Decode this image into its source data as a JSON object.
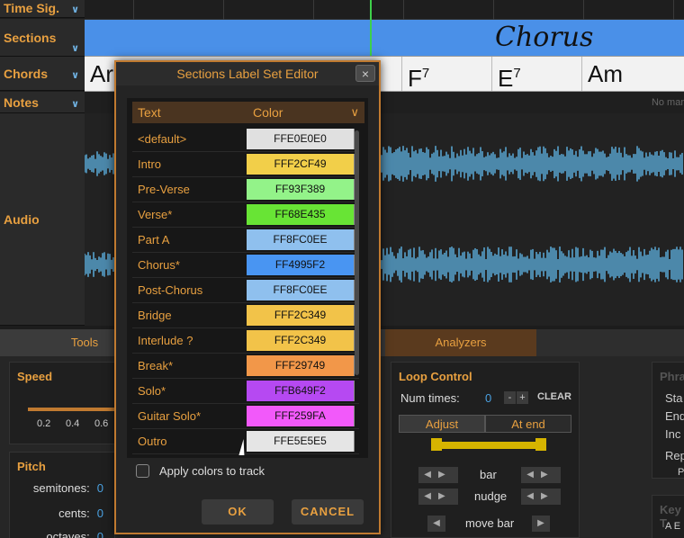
{
  "tracks": {
    "time_sig": "Time Sig.",
    "sections": "Sections",
    "chords": "Chords",
    "notes": "Notes",
    "audio": "Audio"
  },
  "timeline": {
    "section_label": "Chorus",
    "chords": [
      {
        "root": "Ar",
        "sup": ""
      },
      {
        "root": "F",
        "sup": "7"
      },
      {
        "root": "E",
        "sup": "7"
      },
      {
        "root": "Am",
        "sup": ""
      }
    ],
    "no_marker": "No mar",
    "waveform_color": "#5aaad8",
    "playhead_color": "#3ed04a"
  },
  "tabs": {
    "tools": "Tools",
    "analyzers": "Analyzers"
  },
  "speed": {
    "title": "Speed",
    "ticks": [
      "0.2",
      "0.4",
      "0.6"
    ]
  },
  "pitch": {
    "title": "Pitch",
    "rows": [
      {
        "label": "semitones:",
        "value": "0"
      },
      {
        "label": "cents:",
        "value": "0"
      },
      {
        "label": "octaves:",
        "value": "0"
      }
    ]
  },
  "loop": {
    "title": "Loop Control",
    "num_times_label": "Num times:",
    "num_times_value": "0",
    "minus": "-",
    "plus": "+",
    "clear": "CLEAR",
    "adjust": "Adjust",
    "at_end": "At end",
    "bar": "bar",
    "nudge": "nudge",
    "move_bar": "move bar"
  },
  "phrase": {
    "title": "Phra",
    "rows": [
      "Sta",
      "End",
      "Inc",
      "Rep",
      "P"
    ]
  },
  "key": {
    "title": "Key T",
    "value": "A E"
  },
  "dialog": {
    "title": "Sections Label Set Editor",
    "close": "×",
    "header_text": "Text",
    "header_color": "Color",
    "rows": [
      {
        "label": "<default>",
        "code": "FFE0E0E0",
        "color": "#e0e0e0"
      },
      {
        "label": "Intro",
        "code": "FFF2CF49",
        "color": "#f2cf49"
      },
      {
        "label": "Pre-Verse",
        "code": "FF93F389",
        "color": "#93f389"
      },
      {
        "label": "Verse*",
        "code": "FF68E435",
        "color": "#68e435"
      },
      {
        "label": "Part A",
        "code": "FF8FC0EE",
        "color": "#8fc0ee"
      },
      {
        "label": "Chorus*",
        "code": "FF4995F2",
        "color": "#4995f2"
      },
      {
        "label": "Post-Chorus",
        "code": "FF8FC0EE",
        "color": "#8fc0ee"
      },
      {
        "label": "Bridge",
        "code": "FFF2C349",
        "color": "#f2c349"
      },
      {
        "label": "Interlude ?",
        "code": "FFF2C349",
        "color": "#f2c349"
      },
      {
        "label": "Break*",
        "code": "FFF29749",
        "color": "#f29749"
      },
      {
        "label": "Solo*",
        "code": "FFB649F2",
        "color": "#b649f2"
      },
      {
        "label": "Guitar Solo*",
        "code": "FFF259FA",
        "color": "#f259fa"
      },
      {
        "label": "Outro",
        "code": "FFE5E5E5",
        "color": "#e5e5e5"
      }
    ],
    "apply_label": "Apply colors to track",
    "ok": "OK",
    "cancel": "CANCEL"
  }
}
